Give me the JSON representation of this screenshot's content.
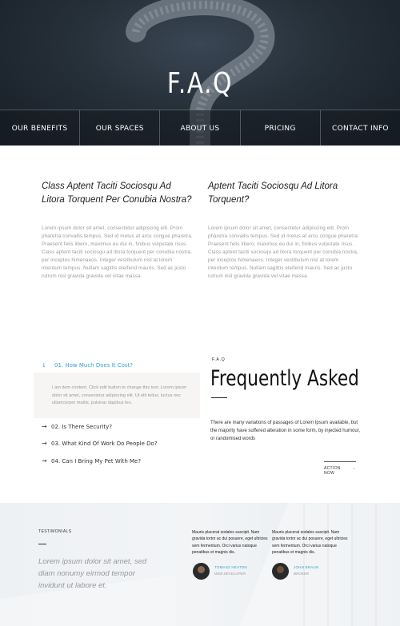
{
  "hero": {
    "title": "F.A.Q"
  },
  "nav": {
    "items": [
      "OUR BENEFITS",
      "OUR SPACES",
      "ABOUT US",
      "PRICING",
      "CONTACT INFO"
    ]
  },
  "questions": [
    {
      "title": "Class Aptent Taciti Sociosqu Ad Litora Torquent Per Conubia Nostra?",
      "text": "Lorem ipsum dolor sit amet, consectetur adipiscing elit. Proin pharetra convallis tempus. Sed id metus at arcu congue pharetra. Praesent felis libero, maximus eu dui in, finibus vulputate risus. Class aptent taciti sociosqu ad litora torquent per conubia nostra, per inceptos himenaeos. Integer vestibulum nisl at lorem interdum tempus. Nullam sagittis eleifend mauris. Sed ac justo rutrum nisl gravida gravida vel vitae massa."
    },
    {
      "title": "Aptent Taciti Sociosqu Ad Litora Torquent?",
      "text": "Lorem ipsum dolor sit amet, consectetur adipiscing elit. Proin pharetra convallis tempus. Sed id metus at arcu congue pharetra. Praesent felis libero, maximus eu dui in, finibus vulputate risus. Class aptent taciti sociosqu ad litora torquent per conubia nostra, per inceptos himenaeos. Integer vestibulum nisl at lorem interdum tempus. Nullam sagittis eleifend mauris. Sed ac justo rutrum nisl gravida gravida vel vitae massa."
    }
  ],
  "accordion": {
    "active": {
      "label": "01. How Much Does It Cost?",
      "content": "I am item content. Click edit button to change this text. Lorem ipsum dolor sit amet, consectetur adipiscing elit. Ut elit tellus, luctus nec ullamcorper mattis, pulvinar dapibus leo.",
      "icon": "arrow-down-icon"
    },
    "items": [
      {
        "label": "02. Is There Security?",
        "icon": "arrow-right-icon"
      },
      {
        "label": "03. What Kind Of Work Do People Do?",
        "icon": "arrow-right-icon"
      },
      {
        "label": "04. Can I Bring My Pet With Me?",
        "icon": "arrow-right-icon"
      }
    ]
  },
  "faq_section": {
    "small_label": "F.A.Q",
    "heading": "Frequently Asked",
    "description": "There are many variations of passages of Lorem Ipsum available, but the majority have suffered alteration in some form, by injected humour, or randomised words",
    "action_label": "ACTION NOW",
    "action_icon": "arrow-right-icon"
  },
  "testimonials": {
    "label": "TESTIMONIALS",
    "quote": "Lorem ipsum dolor sit amet, sed diam nonumy eirmod tempor invidunt ut labore et.",
    "cards": [
      {
        "text": "Mauris placerat sodales suscipit. Nam gravida tortor ac dui posuere, eget ultricies sem fermentum. Orci varius natoque penatibus et magnis dis.",
        "name": "TOMASZ HEATON",
        "role": "WEB DEVELOPER"
      },
      {
        "text": "Mauris placerat sodales suscipit. Nam gravida tortor ac dui posuere, eget ultricies sem fermentum. Orci varius natoque penatibus et magnis dis.",
        "name": "JOHN BRAUN",
        "role": "BROKER"
      }
    ]
  },
  "colors": {
    "accent": "#2ea3d6",
    "hero_bg": "#1d2630",
    "accordion_bg": "#f7f4f4"
  }
}
